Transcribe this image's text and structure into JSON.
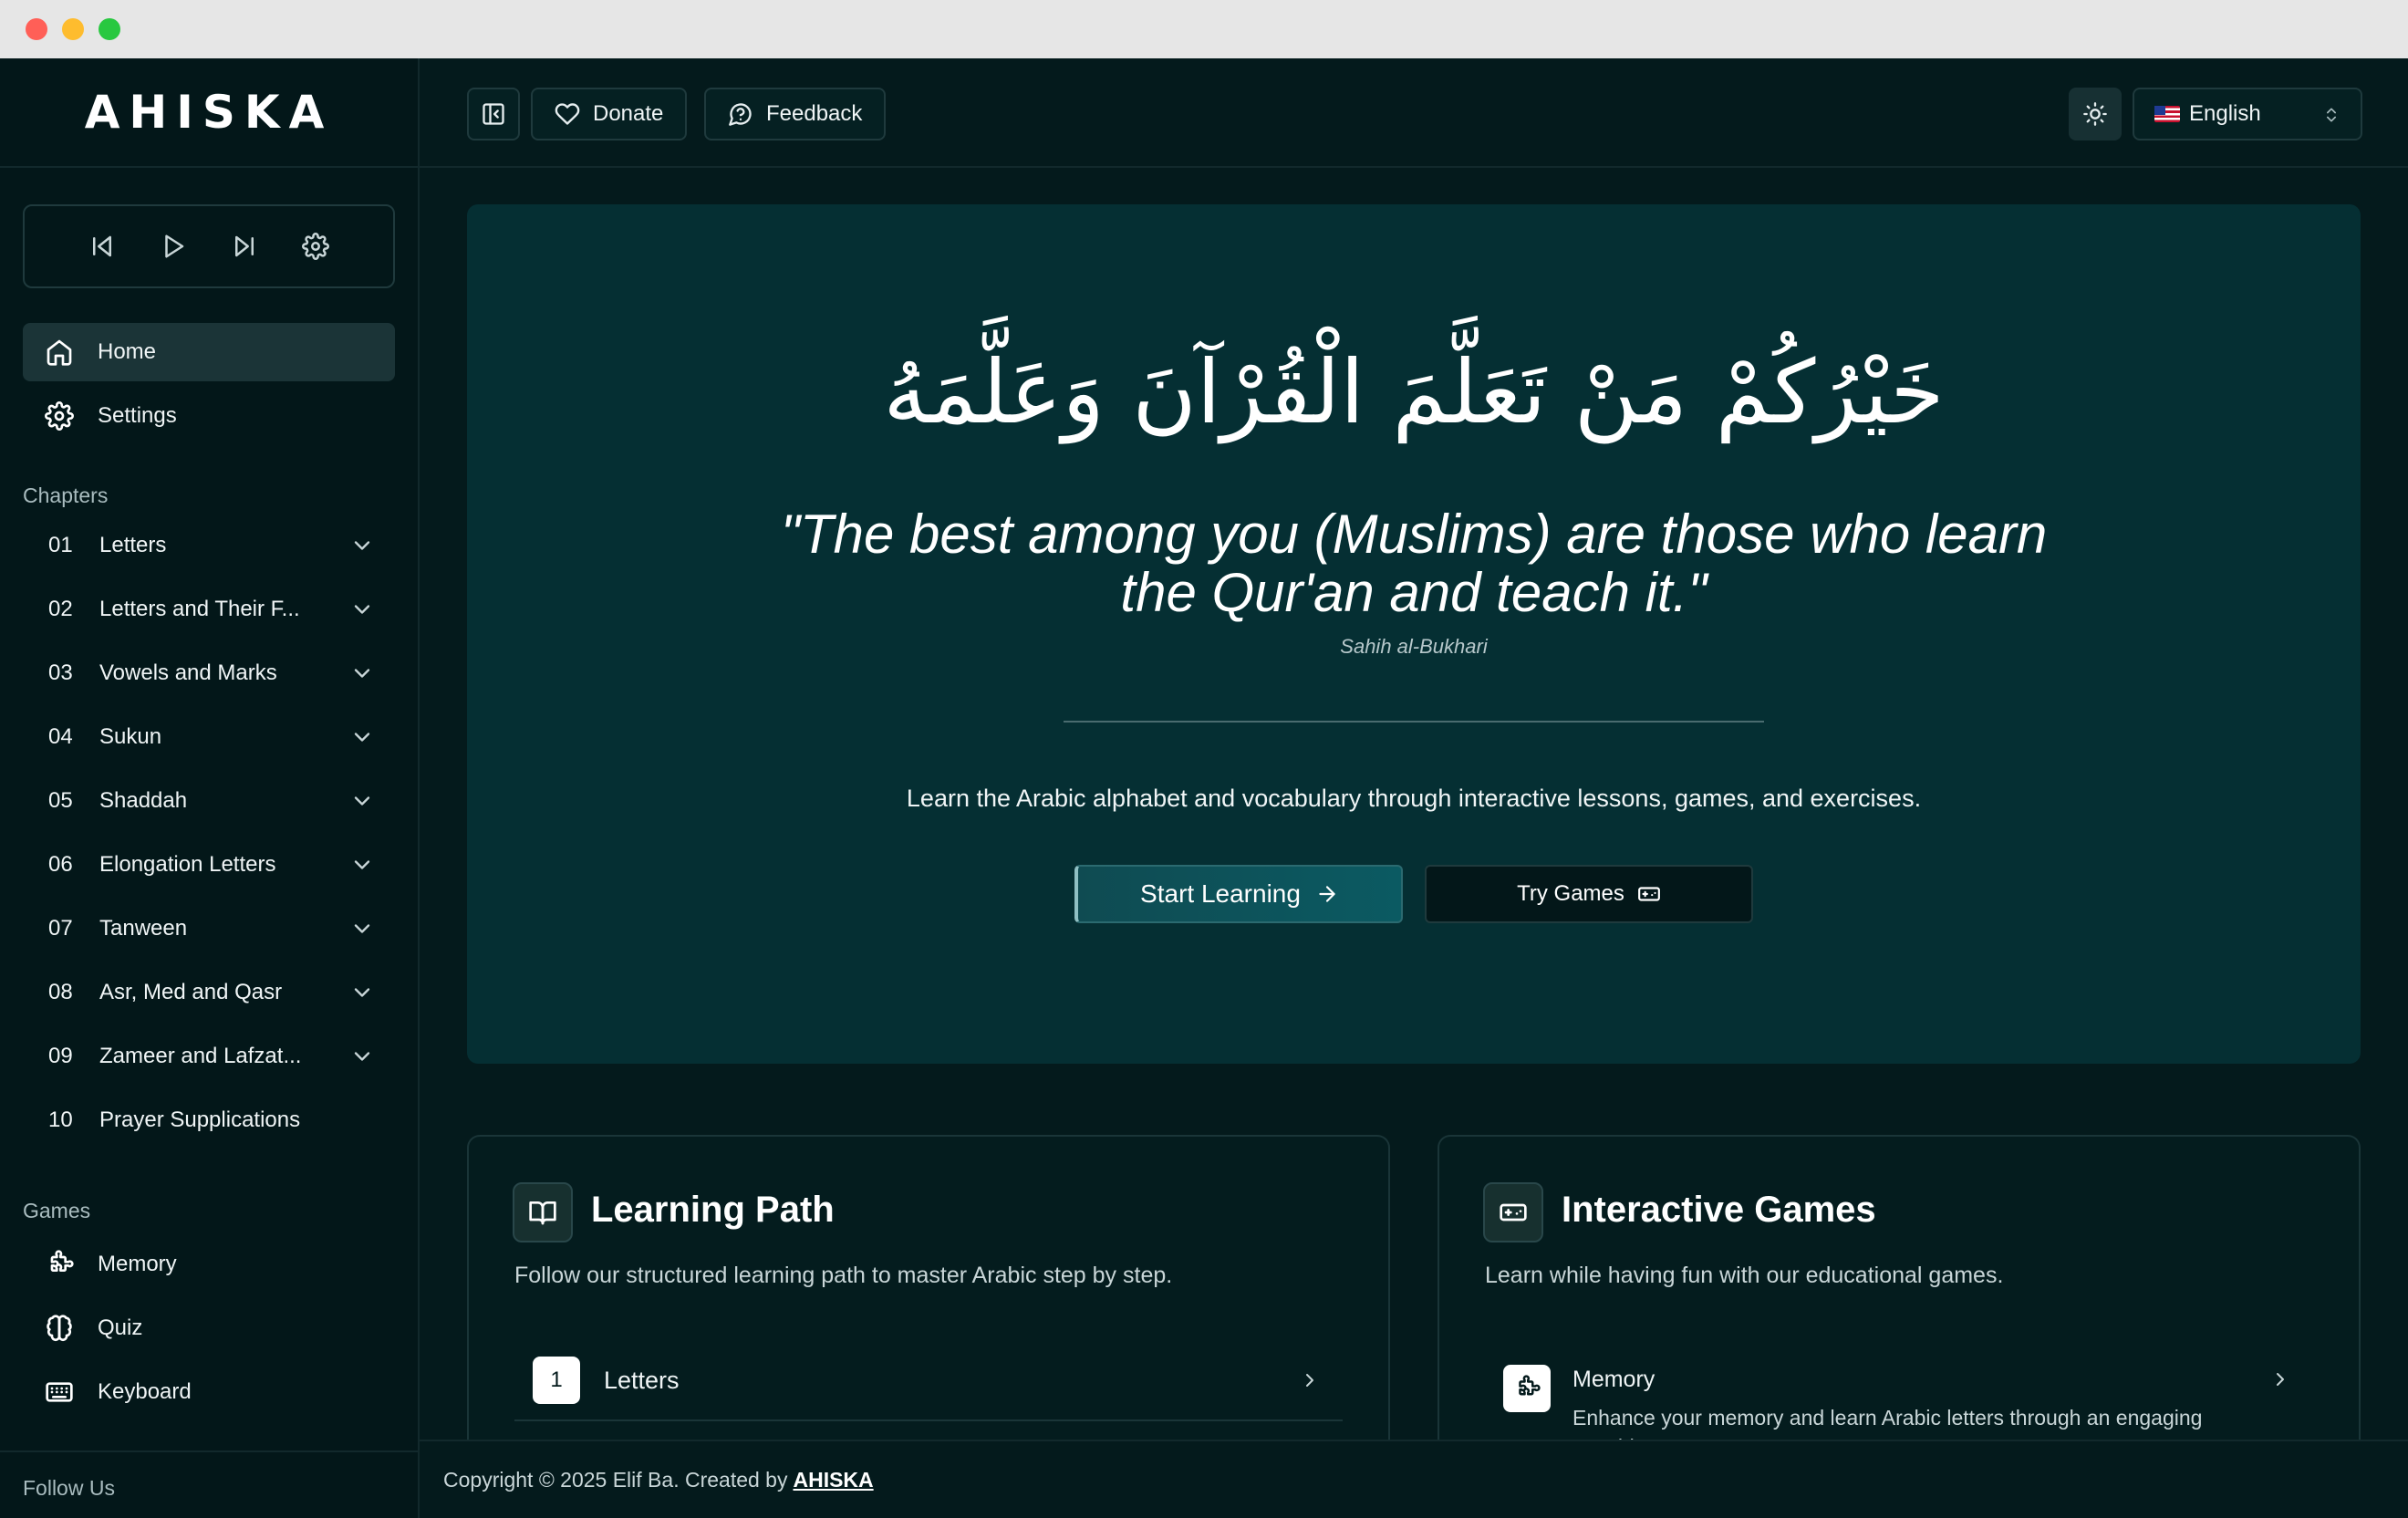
{
  "window": {
    "controls": [
      "close",
      "minimize",
      "maximize"
    ],
    "colors": {
      "close": "#ff5f57",
      "minimize": "#febc2e",
      "maximize": "#28c840"
    }
  },
  "brand": {
    "logo": "AHISKA"
  },
  "player": {
    "controls": [
      "skip-back-icon",
      "play-icon",
      "skip-forward-icon",
      "gear-icon"
    ]
  },
  "nav": {
    "home": "Home",
    "settings": "Settings"
  },
  "sidebar": {
    "chapters_label": "Chapters",
    "chapters": [
      {
        "num": "01",
        "label": "Letters"
      },
      {
        "num": "02",
        "label": "Letters and Their F..."
      },
      {
        "num": "03",
        "label": "Vowels and Marks"
      },
      {
        "num": "04",
        "label": "Sukun"
      },
      {
        "num": "05",
        "label": "Shaddah"
      },
      {
        "num": "06",
        "label": "Elongation Letters"
      },
      {
        "num": "07",
        "label": "Tanween"
      },
      {
        "num": "08",
        "label": "Asr, Med and Qasr"
      },
      {
        "num": "09",
        "label": "Zameer and Lafzat..."
      },
      {
        "num": "10",
        "label": "Prayer Supplications"
      }
    ],
    "games_label": "Games",
    "games": [
      "Memory",
      "Quiz",
      "Keyboard"
    ],
    "follow_label": "Follow Us"
  },
  "topbar": {
    "donate": "Donate",
    "feedback": "Feedback",
    "language": "English"
  },
  "hero": {
    "arabic": "خَيْرُكُمْ مَنْ تَعَلَّمَ الْقُرْآنَ وَعَلَّمَهُ",
    "quote_line1": "\"The best among you (Muslims) are those who learn",
    "quote_line2": "the Qur'an and teach it.\"",
    "source": "Sahih al-Bukhari",
    "description": "Learn the Arabic alphabet and vocabulary through interactive lessons, games, and exercises.",
    "start_button": "Start Learning",
    "games_button": "Try Games"
  },
  "learning_path": {
    "title": "Learning Path",
    "description": "Follow our structured learning path to master Arabic step by step.",
    "items": [
      {
        "num": "1",
        "label": "Letters"
      }
    ]
  },
  "interactive_games": {
    "title": "Interactive Games",
    "description": "Learn while having fun with our educational games.",
    "items": [
      {
        "title": "Memory",
        "description": "Enhance your memory and learn Arabic letters through an engaging matching game."
      }
    ]
  },
  "footer": {
    "copyright": "Copyright © 2025 Elif Ba. Created by",
    "brand": "AHISKA"
  },
  "colors": {
    "background": "#041a1c",
    "sidebar": "#031719",
    "hero": "#052f33",
    "active_item": "#1b3437",
    "accent": "#0b5a62"
  }
}
